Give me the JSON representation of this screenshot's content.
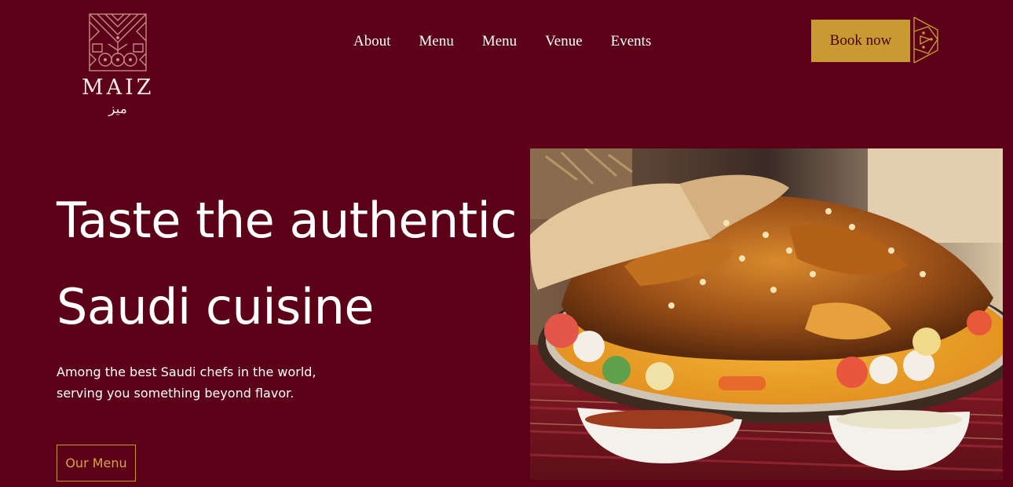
{
  "brand": {
    "name": "MAIZ",
    "arabic": "ميز"
  },
  "nav": {
    "items": [
      {
        "label": "About"
      },
      {
        "label": "Menu"
      },
      {
        "label": "Menu"
      },
      {
        "label": "Venue"
      },
      {
        "label": "Events"
      }
    ]
  },
  "header": {
    "book_label": "Book now"
  },
  "hero": {
    "title_line1": "Taste the authentic",
    "title_line2": "Saudi cuisine",
    "subtitle_line1": "Among the best Saudi chefs in the world,",
    "subtitle_line2": "serving you something beyond flavor.",
    "cta_label": "Our Menu",
    "image_icon": "kabsa-dish-photo"
  },
  "colors": {
    "background": "#5b0016",
    "gold": "#c99a32",
    "gold_text": "#d9a441",
    "text": "#ffffff"
  }
}
